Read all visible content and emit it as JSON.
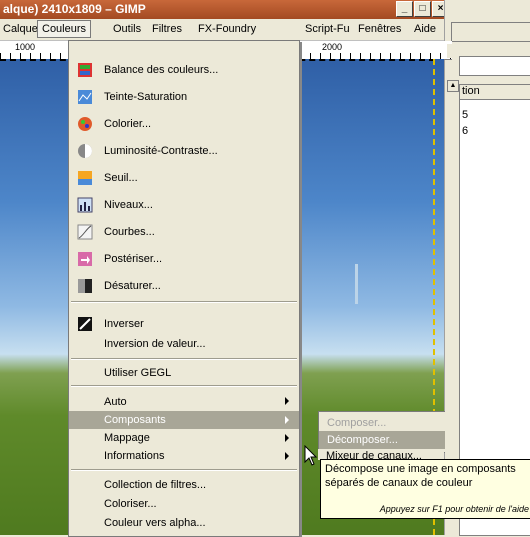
{
  "window": {
    "title": "alque) 2410x1809 – GIMP",
    "buttons": [
      "_",
      "□",
      "×"
    ]
  },
  "menubar": {
    "items": [
      "Calque",
      "Couleurs",
      "Outils",
      "Filtres",
      "FX-Foundry",
      "Script-Fu",
      "Fenêtres",
      "Aide"
    ],
    "active": "Couleurs"
  },
  "ruler": {
    "left_label": "1000",
    "right_label": "2000"
  },
  "right_panel": {
    "column_header": "tion",
    "row1": "5",
    "row2": "6"
  },
  "menu": {
    "items": [
      {
        "label": "Balance des couleurs...",
        "icon": "color-balance-icon"
      },
      {
        "label": "Teinte-Saturation",
        "icon": "hue-saturation-icon"
      },
      {
        "label": "Colorier...",
        "icon": "colorize-icon"
      },
      {
        "label": "Luminosité-Contraste...",
        "icon": "brightness-contrast-icon"
      },
      {
        "label": "Seuil...",
        "icon": "threshold-icon"
      },
      {
        "label": "Niveaux...",
        "icon": "levels-icon"
      },
      {
        "label": "Courbes...",
        "icon": "curves-icon"
      },
      {
        "label": "Postériser...",
        "icon": "posterize-icon"
      },
      {
        "label": "Désaturer...",
        "icon": "desaturate-icon"
      },
      {
        "label": "Inverser",
        "icon": "invert-icon"
      },
      {
        "label": "Inversion de valeur...",
        "icon": ""
      },
      {
        "label": "Utiliser GEGL",
        "icon": ""
      },
      {
        "label": "Auto",
        "icon": "",
        "submenu": true
      },
      {
        "label": "Composants",
        "icon": "",
        "submenu": true,
        "highlighted": true
      },
      {
        "label": "Mappage",
        "icon": "",
        "submenu": true
      },
      {
        "label": "Informations",
        "icon": "",
        "submenu": true
      },
      {
        "label": "Collection de filtres...",
        "icon": ""
      },
      {
        "label": "Coloriser...",
        "icon": ""
      },
      {
        "label": "Couleur vers alpha...",
        "icon": ""
      }
    ]
  },
  "submenu": {
    "items": [
      {
        "label": "Composer...",
        "state": "disabled"
      },
      {
        "label": "Décomposer...",
        "state": "highlighted"
      },
      {
        "label": "Mixeur de canaux...",
        "state": "partial"
      }
    ]
  },
  "tooltip": {
    "line1": "Décompose une image en composants",
    "line2": "séparés de canaux de couleur",
    "help": "Appuyez sur F1 pour obtenir de l'aide"
  }
}
